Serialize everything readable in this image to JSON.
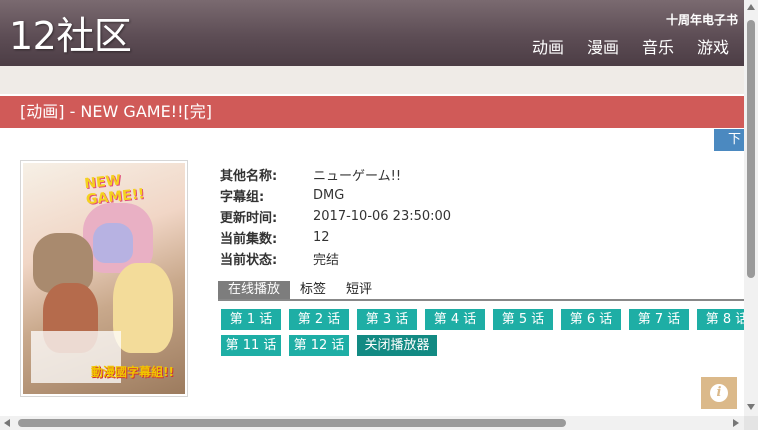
{
  "header": {
    "logo": "12社区",
    "ebook_link": "十周年电子书",
    "nav": [
      "动画",
      "漫画",
      "音乐",
      "游戏"
    ]
  },
  "title_bar": {
    "text": "[动画] - NEW GAME!![完]"
  },
  "download_tab": {
    "label": "下"
  },
  "poster": {
    "logo_text": "NEW GAME!!",
    "sub_logo": "動漫國字幕組!!",
    "icon": "poster-image"
  },
  "info": {
    "rows": [
      {
        "label": "其他名称:",
        "value": "ニューゲーム!!"
      },
      {
        "label": "字幕组:",
        "value": "DMG"
      },
      {
        "label": "更新时间:",
        "value": "2017-10-06 23:50:00"
      },
      {
        "label": "当前集数:",
        "value": "12"
      },
      {
        "label": "当前状态:",
        "value": "完结"
      }
    ]
  },
  "tabs": [
    "在线播放",
    "标签",
    "短评"
  ],
  "episodes": {
    "row1": [
      "第 1 话",
      "第 2 话",
      "第 3 话",
      "第 4 话",
      "第 5 话",
      "第 6 话",
      "第 7 话",
      "第 8 话"
    ],
    "row2": [
      "第 11 话",
      "第 12 话"
    ],
    "close_player": "关闭播放器"
  },
  "info_button": {
    "glyph": "i",
    "icon": "info-icon"
  },
  "colors": {
    "header_bg": "#5d4d55",
    "title_bar": "#d05a58",
    "episode_button": "#1eaea5",
    "close_button": "#128a83",
    "download_tab": "#4b89c0",
    "info_button": "#dbb98a"
  }
}
